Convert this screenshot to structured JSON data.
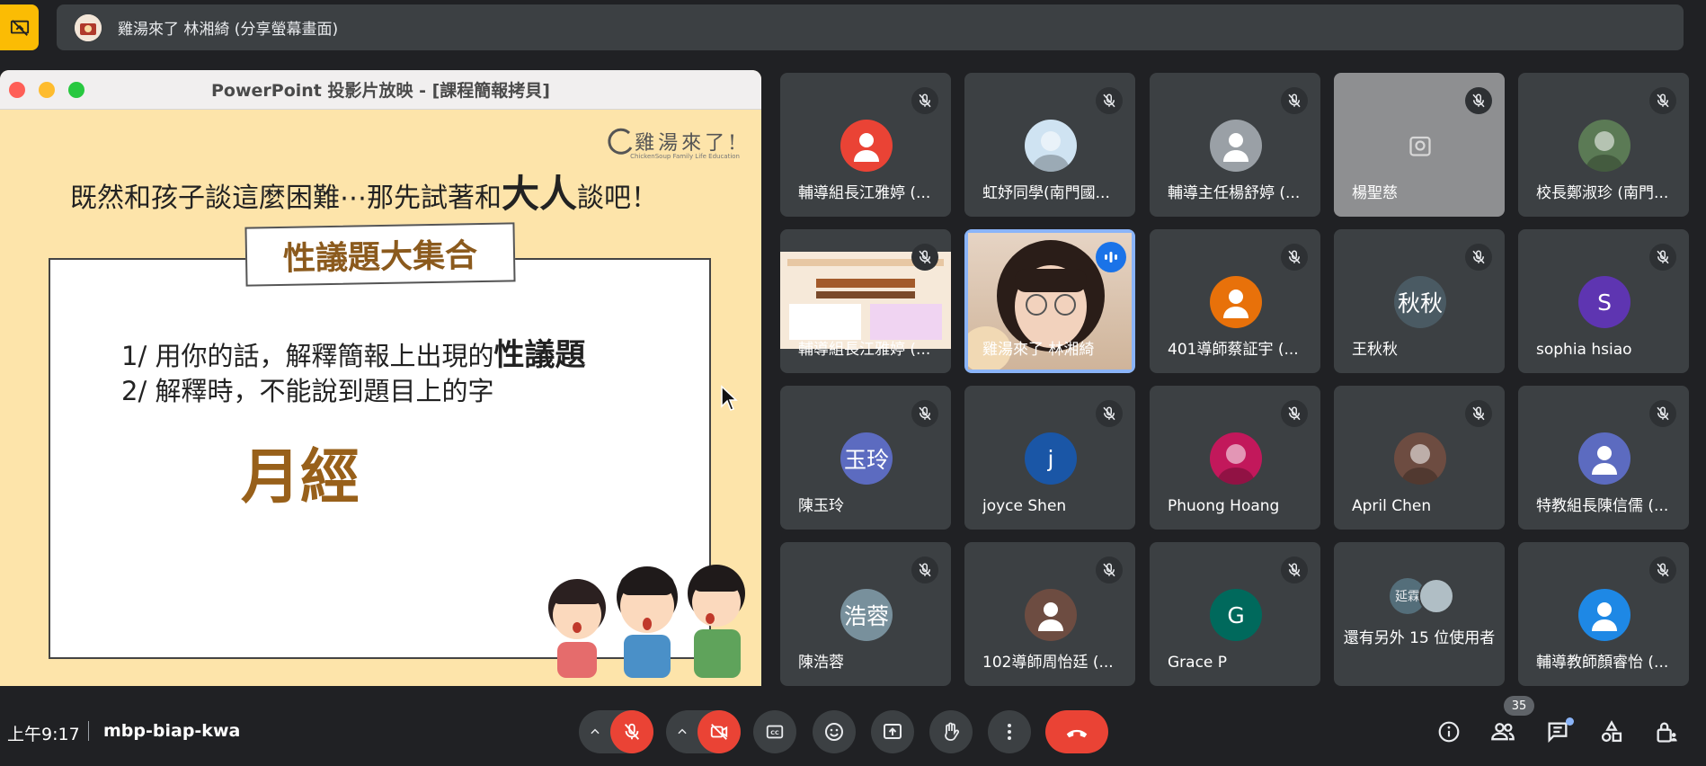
{
  "top_bar": {
    "presenter_title": "雞湯來了 林湘綺 (分享螢幕畫面)"
  },
  "presentation": {
    "window_title": "PowerPoint 投影片放映 - [課程簡報拷貝]",
    "logo_text": "雞湯來了!",
    "logo_subtext": "ChickenSoup Family Life Education",
    "headline_part1": "既然和孩子談這麼困難⋯那先試著和",
    "headline_emph": "大人",
    "headline_part2": "談吧！",
    "card_title": "性議題大集合",
    "rule1_text": "1/ 用你的話，解釋簡報上出現的",
    "rule1_emph": "性議題",
    "rule2_text": "2/ 解釋時，不能說到題目上的字",
    "answer_word": "月經"
  },
  "participants": [
    {
      "name": "輔導組長江雅婷 (...",
      "avatar": "person",
      "avatar_color": "#ea4335",
      "muted": true
    },
    {
      "name": "虹妤同學(南門國...",
      "avatar": "photo",
      "avatar_color": "#cfe3f2",
      "muted": true
    },
    {
      "name": "輔導主任楊舒婷 (...",
      "avatar": "person",
      "avatar_color": "#9aa0a6",
      "muted": true
    },
    {
      "name": "楊聖慈",
      "avatar": "video-off",
      "avatar_color": "#8e8f91",
      "muted": true
    },
    {
      "name": "校長鄭淑珍 (南門...",
      "avatar": "photo",
      "avatar_color": "#5b7a55",
      "muted": true
    },
    {
      "name": "輔導組長江雅婷 (...",
      "avatar": "flyer",
      "avatar_color": "#f6e9d9",
      "muted": true
    },
    {
      "name": "雞湯來了 林湘綺",
      "avatar": "video",
      "avatar_color": "#d6c2ae",
      "muted": false
    },
    {
      "name": "401導師蔡証宇 (...",
      "avatar": "person",
      "avatar_color": "#e8710a",
      "muted": true
    },
    {
      "name": "王秋秋",
      "avatar": "秋秋",
      "avatar_color": "#4a5a63",
      "muted": true
    },
    {
      "name": "sophia hsiao",
      "avatar": "S",
      "avatar_color": "#5e35b1",
      "muted": true
    },
    {
      "name": "陳玉玲",
      "avatar": "玉玲",
      "avatar_color": "#5c6bc0",
      "muted": true
    },
    {
      "name": "joyce Shen",
      "avatar": "j",
      "avatar_color": "#1a56a6",
      "muted": true
    },
    {
      "name": "Phuong Hoang",
      "avatar": "photo",
      "avatar_color": "#c2185b",
      "muted": true
    },
    {
      "name": "April Chen",
      "avatar": "photo",
      "avatar_color": "#6d4c41",
      "muted": true
    },
    {
      "name": "特教組長陳信儒 (...",
      "avatar": "person",
      "avatar_color": "#5c6bc0",
      "muted": true
    },
    {
      "name": "陳浩蓉",
      "avatar": "浩蓉",
      "avatar_color": "#78909c",
      "muted": true
    },
    {
      "name": "102導師周怡廷 (...",
      "avatar": "person",
      "avatar_color": "#6d4c41",
      "muted": true
    },
    {
      "name": "Grace P",
      "avatar": "G",
      "avatar_color": "#00695c",
      "muted": true
    },
    {
      "name": "還有另外 15 位使用者",
      "avatar": "延霖",
      "avatar_color": "#546e7a",
      "muted": false
    },
    {
      "name": "輔導教師顏睿怡 (...",
      "avatar": "person",
      "avatar_color": "#1e88e5",
      "muted": true
    }
  ],
  "bottom_bar": {
    "time": "上午9:17",
    "meeting_code": "mbp-biap-kwa",
    "people_count": "35"
  },
  "icons": {
    "mic_off": "mic-off-icon",
    "camera_off": "camera-off-icon",
    "captions": "captions-icon",
    "emoji": "emoji-icon",
    "present": "present-icon",
    "raise_hand": "raise-hand-icon",
    "more": "more-options-icon",
    "end_call": "end-call-icon",
    "info": "info-icon",
    "people": "people-icon",
    "chat": "chat-icon",
    "activities": "activities-icon",
    "host_controls": "lock-person-icon"
  },
  "colors": {
    "background": "#202124",
    "surface": "#3c4043",
    "danger": "#ea4335",
    "presenting": "#fbbc04",
    "speaking": "#8ab4f8"
  }
}
